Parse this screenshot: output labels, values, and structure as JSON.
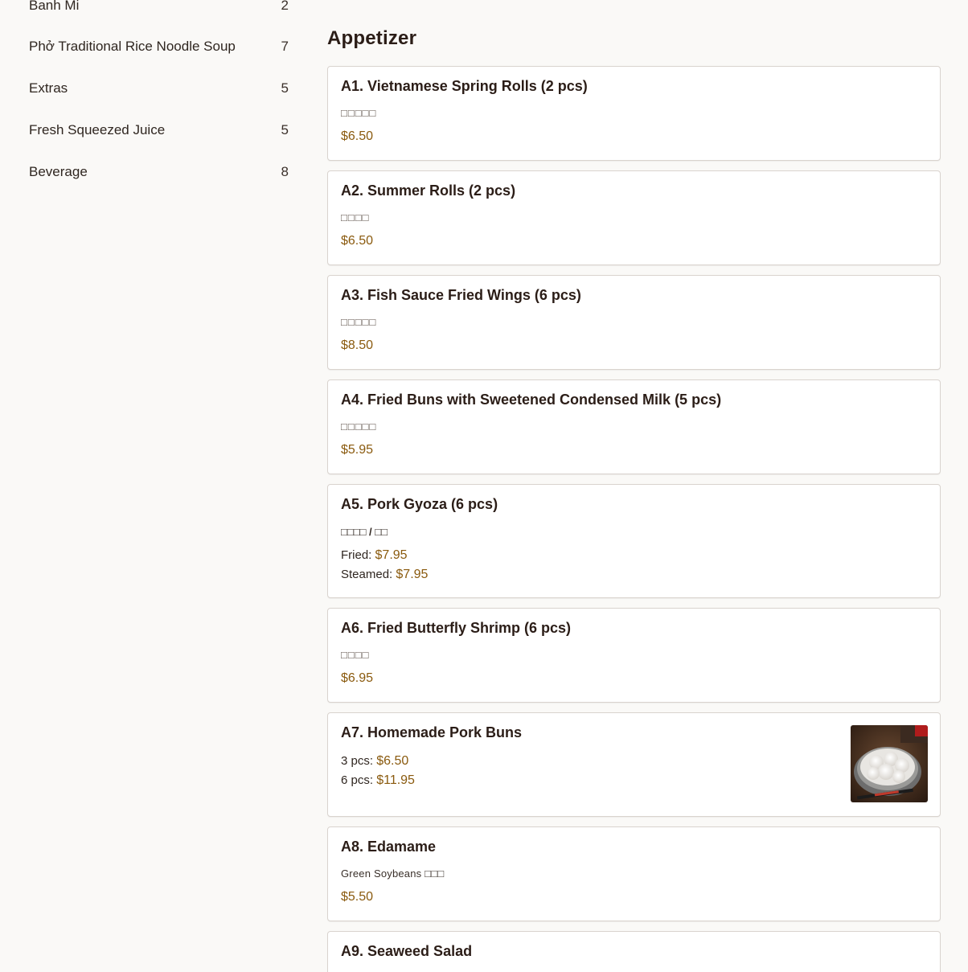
{
  "sidebar": {
    "categories": [
      {
        "label": "Banh Mi",
        "count": "2"
      },
      {
        "label": "Phở Traditional Rice Noodle Soup",
        "count": "7"
      },
      {
        "label": "Extras",
        "count": "5"
      },
      {
        "label": "Fresh Squeezed Juice",
        "count": "5"
      },
      {
        "label": "Beverage",
        "count": "8"
      }
    ]
  },
  "main": {
    "section_title": "Appetizer",
    "items": [
      {
        "name": "A1. Vietnamese Spring Rolls (2 pcs)",
        "desc": "□□□□□",
        "price": "$6.50"
      },
      {
        "name": "A2. Summer Rolls (2 pcs)",
        "desc": "□□□□",
        "price": "$6.50"
      },
      {
        "name": "A3. Fish Sauce Fried Wings (6 pcs)",
        "desc": "□□□□□",
        "price": "$8.50"
      },
      {
        "name": "A4. Fried Buns with Sweetened Condensed Milk (5 pcs)",
        "desc": "□□□□□",
        "price": "$5.95"
      },
      {
        "name": "A5. Pork Gyoza (6 pcs)",
        "desc": "□□□□ / □□",
        "options": [
          {
            "label": "Fried:",
            "price": "$7.95"
          },
          {
            "label": "Steamed:",
            "price": "$7.95"
          }
        ]
      },
      {
        "name": "A6. Fried Butterfly Shrimp (6 pcs)",
        "desc": "□□□□",
        "price": "$6.95"
      },
      {
        "name": "A7. Homemade Pork Buns",
        "options": [
          {
            "label": "3 pcs:",
            "price": "$6.50"
          },
          {
            "label": "6 pcs:",
            "price": "$11.95"
          }
        ],
        "image": "pork-buns-photo"
      },
      {
        "name": "A8. Edamame",
        "desc": "Green Soybeans □□□",
        "price": "$5.50"
      },
      {
        "name": "A9. Seaweed Salad"
      }
    ]
  },
  "colors": {
    "background": "#faf9f7",
    "card_border": "#d9d3ce",
    "price": "#8a5a0e",
    "text": "#2b1d17"
  }
}
